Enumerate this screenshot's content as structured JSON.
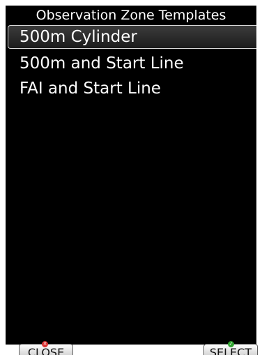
{
  "dialog": {
    "title": "Observation Zone Templates"
  },
  "templates": {
    "items": [
      {
        "label": "500m Cylinder",
        "selected": true
      },
      {
        "label": "500m and Start Line",
        "selected": false
      },
      {
        "label": "FAI and Start Line",
        "selected": false
      }
    ]
  },
  "buttons": {
    "close_label": "CLOSE",
    "select_label": "SELECT",
    "close_icon": "close-icon",
    "select_icon": "check-icon"
  },
  "colors": {
    "background": "#000000",
    "text": "#ffffff",
    "close_icon": "#d93030",
    "select_icon": "#2fa32f"
  }
}
